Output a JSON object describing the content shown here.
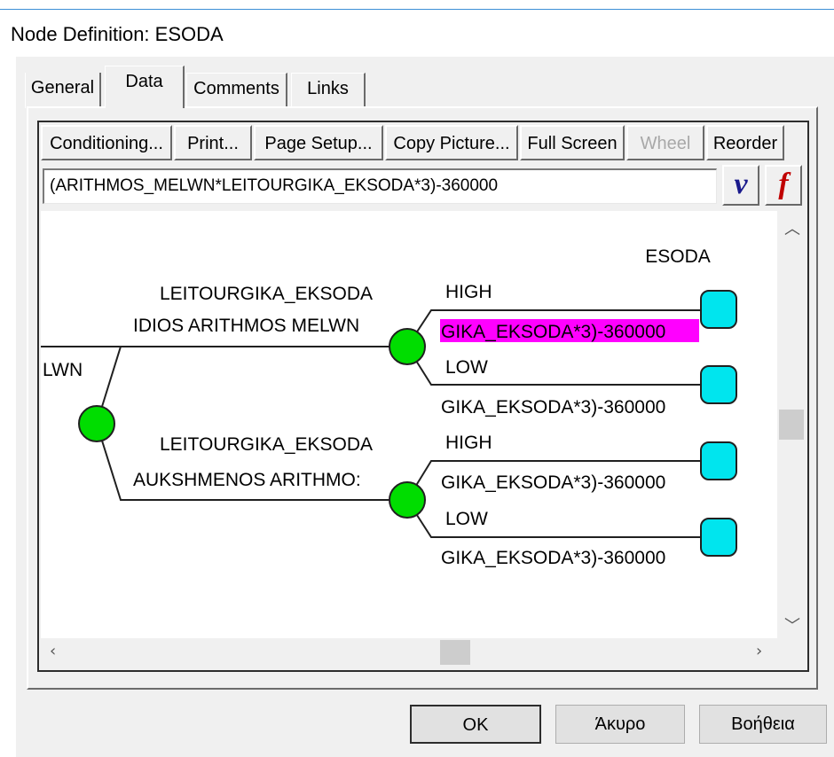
{
  "window": {
    "title": "Node Definition: ESODA"
  },
  "tabs": [
    {
      "label": "General"
    },
    {
      "label": "Data",
      "active": true
    },
    {
      "label": "Comments"
    },
    {
      "label": "Links"
    }
  ],
  "toolbar": {
    "conditioning": "Conditioning...",
    "print": "Print...",
    "page_setup": "Page Setup...",
    "copy_picture": "Copy Picture...",
    "full_screen": "Full Screen",
    "wheel": "Wheel",
    "reorder": "Reorder"
  },
  "formula": {
    "value": "(ARITHMOS_MELWN*LEITOURGIKA_EKSODA*3)-360000",
    "v_button": "v",
    "f_button": "f"
  },
  "tree": {
    "header": "ESODA",
    "root_label": "LWN",
    "branches": [
      {
        "var_label": "LEITOURGIKA_EKSODA",
        "branch_label": "IDIOS ARITHMOS MELWN",
        "outcomes": [
          {
            "label": "HIGH",
            "value": "GIKA_EKSODA*3)-360000",
            "highlighted": true
          },
          {
            "label": "LOW",
            "value": "GIKA_EKSODA*3)-360000",
            "highlighted": false
          }
        ]
      },
      {
        "var_label": "LEITOURGIKA_EKSODA",
        "branch_label": "AUKSHMENOS ARITHMO:",
        "outcomes": [
          {
            "label": "HIGH",
            "value": "GIKA_EKSODA*3)-360000",
            "highlighted": false
          },
          {
            "label": "LOW",
            "value": "GIKA_EKSODA*3)-360000",
            "highlighted": false
          }
        ]
      }
    ]
  },
  "colors": {
    "chance_node": "#00dd00",
    "terminal_node": "#00e5ee",
    "highlight": "#ff00ff",
    "line": "#202020"
  },
  "buttons": {
    "ok": "OK",
    "cancel": "Άκυρο",
    "help": "Βοήθεια"
  }
}
